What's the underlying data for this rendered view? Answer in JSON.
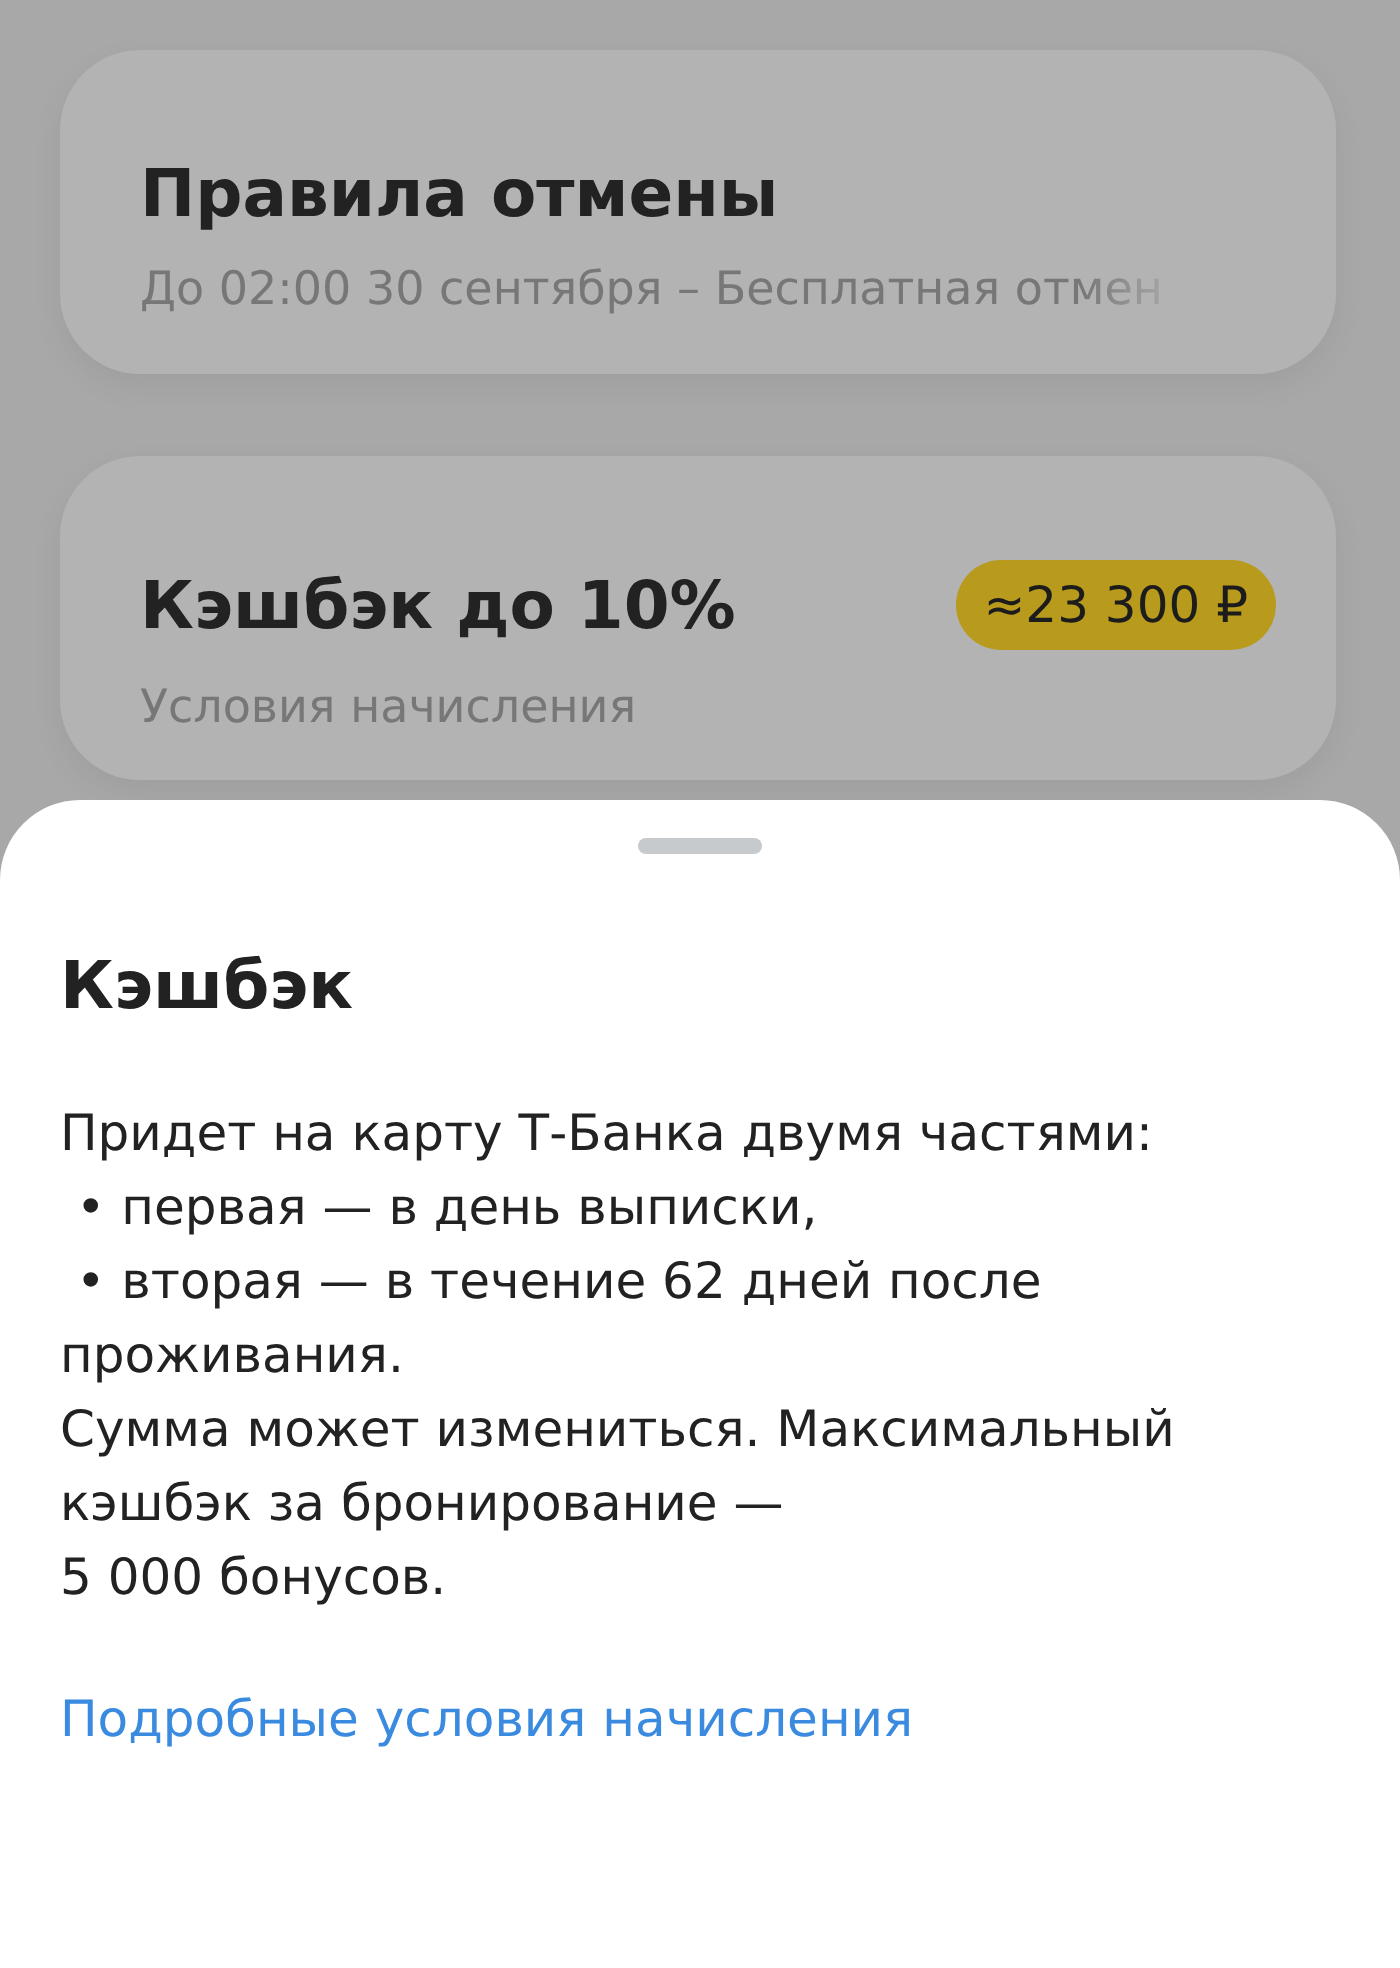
{
  "cards": [
    {
      "title": "Правила отмены",
      "subtitle": "До 02:00 30 сентября – Бесплатная отмен",
      "faded": true
    },
    {
      "title": "Кэшбэк до 10%",
      "subtitle": "Условия начисления",
      "badge": "≈23 300 ₽",
      "faded": false
    }
  ],
  "sheet": {
    "title": "Кэшбэк",
    "text": "Придет на карту Т-Банка двумя частями:\n • первая — в день выписки,\n • вторая — в течение 62 дней после проживания.\nСумма может измениться. Максимальный кэшбэк за бронирование —\n5 000 бонусов.",
    "link": "Подробные условия начисления"
  }
}
